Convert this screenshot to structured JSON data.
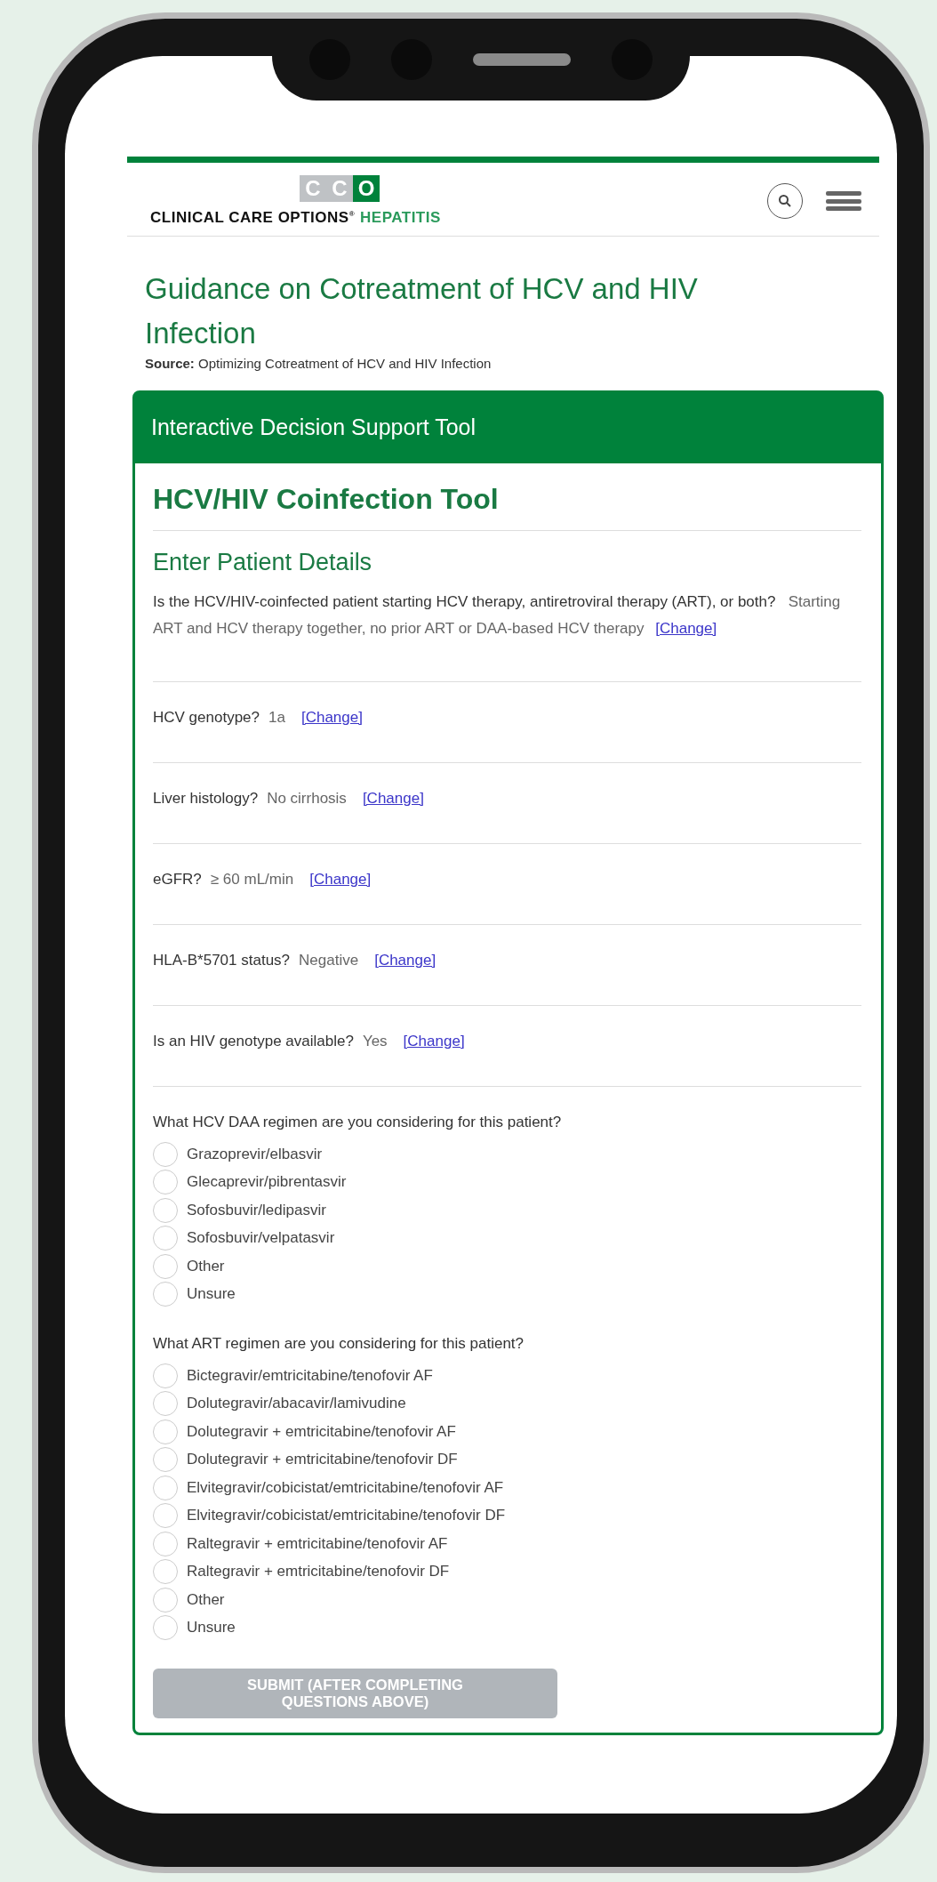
{
  "brand": {
    "logo_letters": [
      "C",
      "C",
      "O"
    ],
    "name": "CLINICAL CARE OPTIONS",
    "mark": "®",
    "section": "HEPATITIS"
  },
  "page": {
    "title": "Guidance on Cotreatment of HCV and HIV Infection",
    "source_label": "Source:",
    "source": "Optimizing Cotreatment of HCV and HIV Infection"
  },
  "tool": {
    "header": "Interactive Decision Support Tool",
    "title": "HCV/HIV Coinfection Tool",
    "section": "Enter Patient Details",
    "answers": [
      {
        "question": "Is the HCV/HIV-coinfected patient starting HCV therapy, antiretroviral therapy (ART), or both?",
        "answer": "Starting ART and HCV therapy together, no prior ART or DAA-based HCV therapy",
        "link": "[Change]"
      },
      {
        "question": "HCV genotype?",
        "answer": "1a",
        "link": "[Change]"
      },
      {
        "question": "Liver histology?",
        "answer": "No cirrhosis",
        "link": "[Change]"
      },
      {
        "question": "eGFR?",
        "answer": "≥ 60 mL/min",
        "link": "[Change]"
      },
      {
        "question": "HLA-B*5701 status?",
        "answer": "Negative",
        "link": "[Change]"
      },
      {
        "question": "Is an HIV genotype available?",
        "answer": "Yes",
        "link": "[Change]"
      }
    ],
    "questions": [
      {
        "question": "What HCV DAA regimen are you considering for this patient?",
        "options": [
          {
            "label": "Grazoprevir/elbasvir",
            "selected": false
          },
          {
            "label": "Glecaprevir/pibrentasvir",
            "selected": false
          },
          {
            "label": "Sofosbuvir/ledipasvir",
            "selected": false
          },
          {
            "label": "Sofosbuvir/velpatasvir",
            "selected": false
          },
          {
            "label": "Other",
            "selected": false
          },
          {
            "label": "Unsure",
            "selected": false
          }
        ]
      },
      {
        "question": "What ART regimen are you considering for this patient?",
        "options": [
          {
            "label": "Bictegravir/emtricitabine/tenofovir AF",
            "selected": false
          },
          {
            "label": "Dolutegravir/abacavir/lamivudine",
            "selected": false
          },
          {
            "label": "Dolutegravir + emtricitabine/tenofovir AF",
            "selected": false
          },
          {
            "label": "Dolutegravir + emtricitabine/tenofovir DF",
            "selected": false
          },
          {
            "label": "Elvitegravir/cobicistat/emtricitabine/tenofovir AF",
            "selected": false
          },
          {
            "label": "Elvitegravir/cobicistat/emtricitabine/tenofovir DF",
            "selected": false
          },
          {
            "label": "Raltegravir + emtricitabine/tenofovir AF",
            "selected": false
          },
          {
            "label": "Raltegravir + emtricitabine/tenofovir DF",
            "selected": false
          },
          {
            "label": "Other",
            "selected": false
          },
          {
            "label": "Unsure",
            "selected": false
          }
        ]
      }
    ],
    "submit": {
      "label": "SUBMIT (AFTER COMPLETING QUESTIONS ABOVE)",
      "disabled": true
    }
  }
}
